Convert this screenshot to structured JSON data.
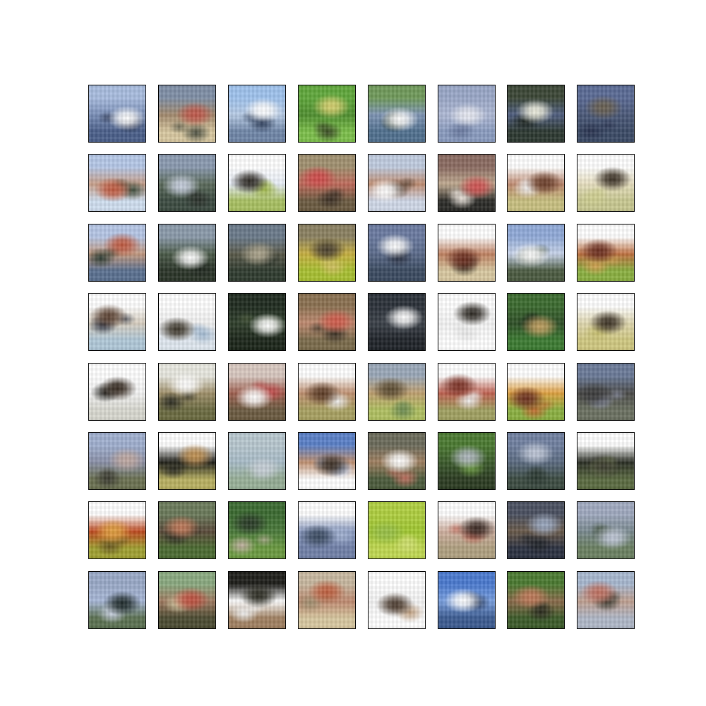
{
  "figure": {
    "background": "#ffffff",
    "tile_border": "#000000"
  },
  "grid": {
    "rows": 8,
    "cols": 8,
    "samples": [
      [
        {
          "sky": "#a9bde0",
          "mid": "#7a8fb8",
          "ground": "#4a5f8a",
          "blob": "#ffffff",
          "blob2": "#2b3550"
        },
        {
          "sky": "#7f8fa6",
          "mid": "#a38a6e",
          "ground": "#d8c8a0",
          "blob": "#c0574a",
          "blob2": "#4a4e40"
        },
        {
          "sky": "#9fc3ee",
          "mid": "#b8cce6",
          "ground": "#6f86a8",
          "blob": "#ffffff",
          "blob2": "#2d3d5a"
        },
        {
          "sky": "#5fa83a",
          "mid": "#4f8f2f",
          "ground": "#7cc04a",
          "blob": "#d8d070",
          "blob2": "#3a4a25"
        },
        {
          "sky": "#6f9a5a",
          "mid": "#7f95b5",
          "ground": "#50708f",
          "blob": "#ffffff",
          "blob2": "#2a3a2a"
        },
        {
          "sky": "#9aa8c8",
          "mid": "#b0bad6",
          "ground": "#8a9cc0",
          "blob": "#e8eaf2",
          "blob2": "#6a7aa0"
        },
        {
          "sky": "#3a4635",
          "mid": "#4f5e80",
          "ground": "#2c3830",
          "blob": "#f0f0e0",
          "blob2": "#1e2620"
        },
        {
          "sky": "#5a6a95",
          "mid": "#4a5878",
          "ground": "#3a4a66",
          "blob": "#6a6050",
          "blob2": "#2a3350"
        }
      ],
      [
        {
          "sky": "#b5c8e8",
          "mid": "#c9a08a",
          "ground": "#d0dff0",
          "blob": "#c05a40",
          "blob2": "#3a4a3a"
        },
        {
          "sky": "#8a9ab0",
          "mid": "#5a6a5a",
          "ground": "#3a4a40",
          "blob": "#c8d0e0",
          "blob2": "#2a302a"
        },
        {
          "sky": "#ffffff",
          "mid": "#e8eef8",
          "ground": "#a8c060",
          "blob": "#2a2620",
          "blob2": "#a0b848"
        },
        {
          "sky": "#a0906f",
          "mid": "#c06a5a",
          "ground": "#6a5a40",
          "blob": "#d04a4a",
          "blob2": "#3a2e24"
        },
        {
          "sky": "#c0cce0",
          "mid": "#c08c70",
          "ground": "#d0d8e8",
          "blob": "#ffffff",
          "blob2": "#4a3a2e"
        },
        {
          "sky": "#8a6a60",
          "mid": "#c0aa90",
          "ground": "#2a2a26",
          "blob": "#d05050",
          "blob2": "#f0e8e0"
        },
        {
          "sky": "#ffffff",
          "mid": "#c08a70",
          "ground": "#c8c080",
          "blob": "#6a3e2a",
          "blob2": "#f0f0f0"
        },
        {
          "sky": "#ffffff",
          "mid": "#e8e0c0",
          "ground": "#c8c890",
          "blob": "#3a3024",
          "blob2": "#d0d090"
        }
      ],
      [
        {
          "sky": "#b5c6e6",
          "mid": "#c49a80",
          "ground": "#5a7090",
          "blob": "#c05a40",
          "blob2": "#2a3a30"
        },
        {
          "sky": "#8a9aaa",
          "mid": "#4a5a48",
          "ground": "#2a3428",
          "blob": "#ffffff",
          "blob2": "#1e261e"
        },
        {
          "sky": "#6a7a8a",
          "mid": "#5a5a4a",
          "ground": "#2e3a2e",
          "blob": "#b0a890",
          "blob2": "#1e261e"
        },
        {
          "sky": "#8a8060",
          "mid": "#c8b040",
          "ground": "#a8c030",
          "blob": "#4a4030",
          "blob2": "#d0c060"
        },
        {
          "sky": "#6a7aa0",
          "mid": "#5a6a8a",
          "ground": "#3a4a60",
          "blob": "#ffffff",
          "blob2": "#2a3040"
        },
        {
          "sky": "#ffffff",
          "mid": "#c08060",
          "ground": "#d8c8a0",
          "blob": "#6a2e20",
          "blob2": "#3a3024"
        },
        {
          "sky": "#90aad8",
          "mid": "#c8d4ea",
          "ground": "#4a5a40",
          "blob": "#ffffff",
          "blob2": "#3a4a30"
        },
        {
          "sky": "#ffffff",
          "mid": "#c07040",
          "ground": "#8ab040",
          "blob": "#6a2e20",
          "blob2": "#d0a050"
        }
      ],
      [
        {
          "sky": "#ffffff",
          "mid": "#d8cfc0",
          "ground": "#b0c8d8",
          "blob": "#5a4030",
          "blob2": "#2a3040"
        },
        {
          "sky": "#ffffff",
          "mid": "#f0f0f0",
          "ground": "#e0e8f0",
          "blob": "#3a3428",
          "blob2": "#a0b8d0"
        },
        {
          "sky": "#1e2a1e",
          "mid": "#2e3e2a",
          "ground": "#1a2418",
          "blob": "#ffffff",
          "blob2": "#4a5a3a"
        },
        {
          "sky": "#8a7050",
          "mid": "#c08a70",
          "ground": "#7a6a4a",
          "blob": "#d05a4a",
          "blob2": "#3a3024"
        },
        {
          "sky": "#2a3038",
          "mid": "#3a4048",
          "ground": "#1e2228",
          "blob": "#ffffff",
          "blob2": "#4a5058"
        },
        {
          "sky": "#ffffff",
          "mid": "#f4f4f4",
          "ground": "#ffffff",
          "blob": "#2a2620",
          "blob2": "#e8e8e8"
        },
        {
          "sky": "#3a6a2e",
          "mid": "#2e4e26",
          "ground": "#3a7a30",
          "blob": "#c0a060",
          "blob2": "#1e2a1a"
        },
        {
          "sky": "#ffffff",
          "mid": "#e0d8b0",
          "ground": "#d0c880",
          "blob": "#3a3024",
          "blob2": "#c8c070"
        }
      ],
      [
        {
          "sky": "#ffffff",
          "mid": "#f4f4f4",
          "ground": "#d8d8d0",
          "blob": "#3a2e24",
          "blob2": "#1e1e1a"
        },
        {
          "sky": "#e8e8e0",
          "mid": "#a0906a",
          "ground": "#6a6a40",
          "blob": "#ffffff",
          "blob2": "#2a2a20"
        },
        {
          "sky": "#d8c8c0",
          "mid": "#a06050",
          "ground": "#6a5a40",
          "blob": "#ffffff",
          "blob2": "#c04a4a"
        },
        {
          "sky": "#ffffff",
          "mid": "#c09070",
          "ground": "#a8a060",
          "blob": "#5a3a24",
          "blob2": "#eeeeee"
        },
        {
          "sky": "#9aa8b8",
          "mid": "#c0a070",
          "ground": "#b0c060",
          "blob": "#5a4a30",
          "blob2": "#6a8a50"
        },
        {
          "sky": "#ffffff",
          "mid": "#c06050",
          "ground": "#a0a060",
          "blob": "#7a3024",
          "blob2": "#eeeeee"
        },
        {
          "sky": "#ffffff",
          "mid": "#e0a040",
          "ground": "#8ab040",
          "blob": "#6a2e20",
          "blob2": "#c06a30"
        },
        {
          "sky": "#6a7a98",
          "mid": "#4a4a48",
          "ground": "#6a7060",
          "blob": "#3a3a3a",
          "blob2": "#8a90a8"
        }
      ],
      [
        {
          "sky": "#a0b0d0",
          "mid": "#8a90a8",
          "ground": "#6a7050",
          "blob": "#c0a8a0",
          "blob2": "#3a3a30"
        },
        {
          "sky": "#ffffff",
          "mid": "#1e1e18",
          "ground": "#b8b060",
          "blob": "#c09050",
          "blob2": "#2a2a20"
        },
        {
          "sky": "#b8c8d0",
          "mid": "#a8bcc8",
          "ground": "#98b098",
          "blob": "#c8d0d8",
          "blob2": "#90a890"
        },
        {
          "sky": "#5a80c8",
          "mid": "#c09070",
          "ground": "#ffffff",
          "blob": "#3a2e24",
          "blob2": "#a8c0e8"
        },
        {
          "sky": "#6a6a5a",
          "mid": "#a08060",
          "ground": "#4a5a3a",
          "blob": "#ffffff",
          "blob2": "#c07060"
        },
        {
          "sky": "#4a7a30",
          "mid": "#3a5a2a",
          "ground": "#2a3a20",
          "blob": "#b0b8c0",
          "blob2": "#6a9a40"
        },
        {
          "sky": "#7080a0",
          "mid": "#5a6a80",
          "ground": "#3a4a40",
          "blob": "#c0c8d8",
          "blob2": "#2a3830"
        },
        {
          "sky": "#ffffff",
          "mid": "#2a2e24",
          "ground": "#5a6a40",
          "blob": "#3a3a2e",
          "blob2": "#8aa060"
        }
      ],
      [
        {
          "sky": "#ffffff",
          "mid": "#c04a20",
          "ground": "#a0a030",
          "blob": "#e0a040",
          "blob2": "#6a5a20"
        },
        {
          "sky": "#6a7a5a",
          "mid": "#5a4a3a",
          "ground": "#4a6a30",
          "blob": "#c07a5a",
          "blob2": "#2a2a20"
        },
        {
          "sky": "#3a6a30",
          "mid": "#4a7a3a",
          "ground": "#6a9a40",
          "blob": "#2a3a28",
          "blob2": "#c0b0a0"
        },
        {
          "sky": "#ffffff",
          "mid": "#8a9ac0",
          "ground": "#7080a8",
          "blob": "#3a4a60",
          "blob2": "#a0b0d0"
        },
        {
          "sky": "#b0d040",
          "mid": "#a0c830",
          "ground": "#c0d850",
          "blob": "#98c048",
          "blob2": "#d0e070"
        },
        {
          "sky": "#ffffff",
          "mid": "#d0b0a0",
          "ground": "#b0a080",
          "blob": "#3a2a24",
          "blob2": "#c06050"
        },
        {
          "sky": "#4a5060",
          "mid": "#6a5a4a",
          "ground": "#2a3040",
          "blob": "#9aa8c0",
          "blob2": "#1e2228"
        },
        {
          "sky": "#a0aac0",
          "mid": "#7a8a90",
          "ground": "#6a8060",
          "blob": "#c0c8d8",
          "blob2": "#4a5a48"
        }
      ],
      [
        {
          "sky": "#9aaac8",
          "mid": "#a8b8d8",
          "ground": "#5a7050",
          "blob": "#1e2a2a",
          "blob2": "#c8d0e0"
        },
        {
          "sky": "#8aaa80",
          "mid": "#a07a60",
          "ground": "#4a4a30",
          "blob": "#c05040",
          "blob2": "#d0c8a0"
        },
        {
          "sky": "#1e1e1a",
          "mid": "#ffffff",
          "ground": "#a08060",
          "blob": "#2a2a20",
          "blob2": "#f0f0f0"
        },
        {
          "sky": "#c8b8a0",
          "mid": "#c08a70",
          "ground": "#d8c8a0",
          "blob": "#c06040",
          "blob2": "#a09070"
        },
        {
          "sky": "#ffffff",
          "mid": "#f4f4f4",
          "ground": "#ffffff",
          "blob": "#4a3a2e",
          "blob2": "#c0a080"
        },
        {
          "sky": "#4a7ad0",
          "mid": "#7aa0e0",
          "ground": "#3a5a90",
          "blob": "#ffffff",
          "blob2": "#2a3a5a"
        },
        {
          "sky": "#4a7a30",
          "mid": "#8a6a4a",
          "ground": "#3a5a28",
          "blob": "#c07a5a",
          "blob2": "#2a2a1e"
        },
        {
          "sky": "#a8b8d0",
          "mid": "#c0a090",
          "ground": "#b0b8c8",
          "blob": "#c07060",
          "blob2": "#3a3a30"
        }
      ]
    ]
  }
}
